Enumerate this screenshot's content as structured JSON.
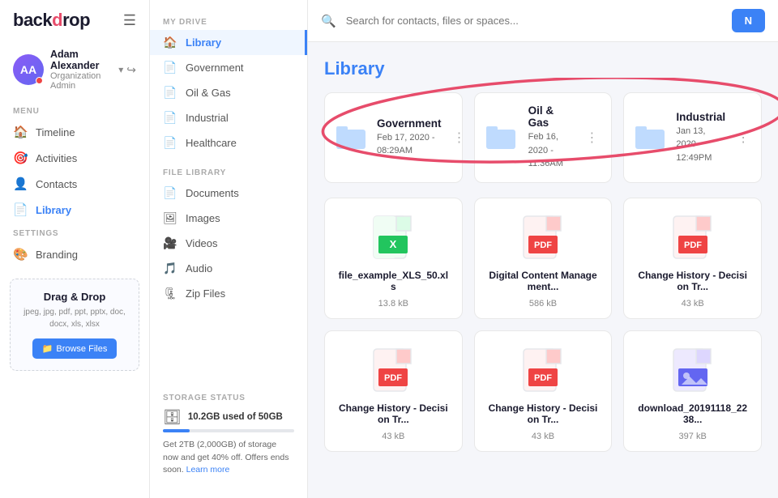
{
  "app": {
    "logo": "backdrop",
    "logo_accent": "rop"
  },
  "user": {
    "name": "Adam Alexander",
    "role": "Organization Admin",
    "initials": "AA"
  },
  "sidebar": {
    "menu_label": "MENU",
    "settings_label": "SETTINGS",
    "nav_items": [
      {
        "id": "timeline",
        "label": "Timeline",
        "icon": "🏠"
      },
      {
        "id": "activities",
        "label": "Activities",
        "icon": "🎯"
      },
      {
        "id": "contacts",
        "label": "Contacts",
        "icon": "👤"
      },
      {
        "id": "library",
        "label": "Library",
        "icon": "📄",
        "active": true
      }
    ],
    "settings_items": [
      {
        "id": "branding",
        "label": "Branding",
        "icon": "🎨"
      }
    ],
    "drag_drop": {
      "title": "Drag & Drop",
      "types": "jpeg, jpg, pdf, ppt, pptx,\ndoc, docx, xls, xlsx",
      "button": "Browse Files"
    }
  },
  "middle_nav": {
    "my_drive_label": "MY DRIVE",
    "my_drive_items": [
      {
        "id": "library",
        "label": "Library",
        "icon": "🏠",
        "active": true
      },
      {
        "id": "government",
        "label": "Government",
        "icon": "📄"
      },
      {
        "id": "oil-gas",
        "label": "Oil & Gas",
        "icon": "📄"
      },
      {
        "id": "industrial",
        "label": "Industrial",
        "icon": "📄"
      },
      {
        "id": "healthcare",
        "label": "Healthcare",
        "icon": "📄"
      }
    ],
    "file_library_label": "FILE LIBRARY",
    "file_library_items": [
      {
        "id": "documents",
        "label": "Documents",
        "icon": "📄"
      },
      {
        "id": "images",
        "label": "Images",
        "icon": "🖼"
      },
      {
        "id": "videos",
        "label": "Videos",
        "icon": "🎥"
      },
      {
        "id": "audio",
        "label": "Audio",
        "icon": "🎵"
      },
      {
        "id": "zip-files",
        "label": "Zip Files",
        "icon": "🗜"
      }
    ],
    "storage_label": "STORAGE STATUS",
    "storage_used": "10.2GB used of 50GB",
    "storage_percent": 20.4,
    "storage_promo": "Get 2TB (2,000GB) of storage now and get 40% off. Offers ends soon.",
    "learn_more": "Learn more"
  },
  "main": {
    "search_placeholder": "Search for contacts, files or spaces...",
    "new_button": "N",
    "page_title": "Library",
    "folders": [
      {
        "name": "Government",
        "date": "Feb 17, 2020 -",
        "time": "08:29AM"
      },
      {
        "name": "Oil & Gas",
        "date": "Feb 16, 2020 -",
        "time": "11:36AM"
      },
      {
        "name": "Industrial",
        "date": "Jan 13, 2020 -",
        "time": "12:49PM"
      }
    ],
    "files": [
      {
        "name": "file_example_XLS_50.xls",
        "size": "13.8 kB",
        "type": "xls"
      },
      {
        "name": "Digital Content Management...",
        "size": "586 kB",
        "type": "pdf-red"
      },
      {
        "name": "Change History - Decision Tr...",
        "size": "43 kB",
        "type": "pdf-red"
      },
      {
        "name": "Change History - Decision Tr...",
        "size": "43 kB",
        "type": "pdf-red"
      },
      {
        "name": "Change History - Decision Tr...",
        "size": "43 kB",
        "type": "pdf-red"
      },
      {
        "name": "download_20191118_2238...",
        "size": "397 kB",
        "type": "img-purple"
      },
      {
        "name": "",
        "size": "",
        "type": "img-purple"
      },
      {
        "name": "",
        "size": "",
        "type": "pdf-red"
      },
      {
        "name": "",
        "size": "",
        "type": "pdf-red"
      }
    ]
  }
}
